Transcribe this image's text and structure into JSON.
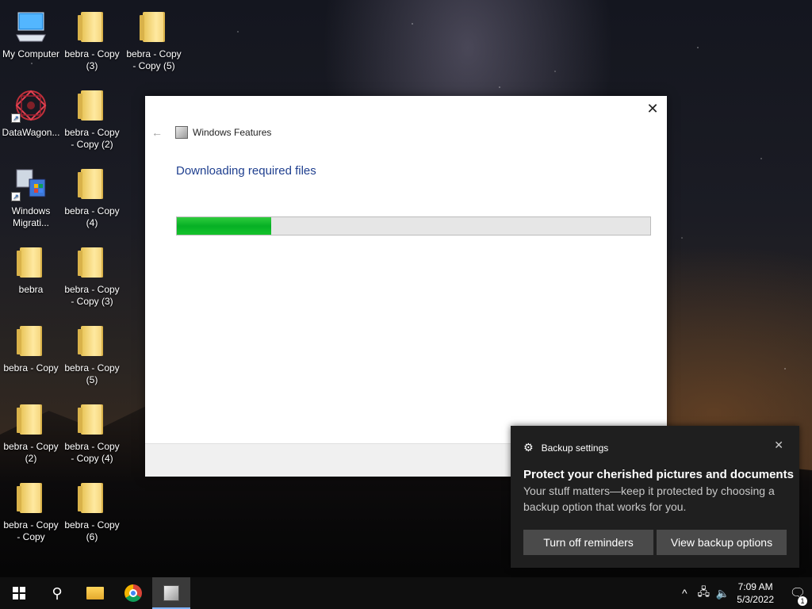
{
  "desktop": {
    "icons": [
      {
        "label": "My Computer",
        "icon": "computer-icon"
      },
      {
        "label": "bebra - Copy (3)",
        "icon": "folder-icon"
      },
      {
        "label": "bebra - Copy - Copy (5)",
        "icon": "folder-icon"
      },
      {
        "label": "DataWagon...",
        "icon": "datawagon-icon"
      },
      {
        "label": "bebra - Copy - Copy (2)",
        "icon": "folder-icon"
      },
      {
        "label": "Windows Migrati...",
        "icon": "windows-migration-icon"
      },
      {
        "label": "bebra - Copy (4)",
        "icon": "folder-icon"
      },
      {
        "label": "bebra",
        "icon": "folder-icon"
      },
      {
        "label": "bebra - Copy - Copy (3)",
        "icon": "folder-icon"
      },
      {
        "label": "bebra - Copy",
        "icon": "folder-icon"
      },
      {
        "label": "bebra - Copy (5)",
        "icon": "folder-icon"
      },
      {
        "label": "bebra - Copy (2)",
        "icon": "folder-icon"
      },
      {
        "label": "bebra - Copy - Copy (4)",
        "icon": "folder-icon"
      },
      {
        "label": "bebra - Copy - Copy",
        "icon": "folder-icon"
      },
      {
        "label": "bebra - Copy (6)",
        "icon": "folder-icon"
      }
    ]
  },
  "dialog": {
    "title": "Windows Features",
    "heading": "Downloading required files",
    "progress_fraction": 0.2,
    "progress_color": "#06b025",
    "close_glyph": "✕",
    "back_glyph": "←"
  },
  "toast": {
    "header": "Backup settings",
    "title": "Protect your cherished pictures and documents",
    "body": "Your stuff matters—keep it protected by choosing a backup option that works for you.",
    "button_1": "Turn off reminders",
    "button_2": "View backup options",
    "close_glyph": "✕",
    "gear_glyph": "⚙"
  },
  "taskbar": {
    "time": "7:09 AM",
    "date": "5/3/2022",
    "notification_count": "1",
    "tray_chevron": "^",
    "search_glyph": "⚲",
    "volume_glyph": "🔈",
    "network_glyph": "🖧",
    "notification_glyph": "🗨"
  }
}
